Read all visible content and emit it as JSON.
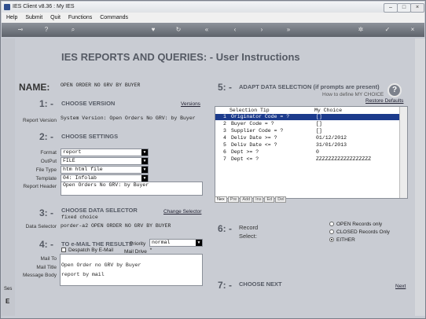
{
  "window": {
    "title": "IES Client v8.36 : My IES"
  },
  "menu": [
    "Help",
    "Submit",
    "Quit",
    "Functions",
    "Commands"
  ],
  "toolbar_icons": [
    "key-icon",
    "help-icon",
    "search-icon",
    "heart-icon",
    "refresh-icon",
    "rewind-icon",
    "back-icon",
    "forward-icon",
    "fast-forward-icon",
    "gear-icon",
    "ok-icon",
    "close-icon"
  ],
  "page": {
    "heading": "IES REPORTS AND QUERIES: -   User Instructions",
    "name_label": "NAME:",
    "name_value": "OPEN ORDER NO GRV  BY BUYER"
  },
  "s1": {
    "num": "1: -",
    "title": "CHOOSE VERSION",
    "link": "Versions",
    "field_label": "Report Version",
    "value": "System Version: Open Orders No GRV: by Buyer"
  },
  "s2": {
    "num": "2: -",
    "title": "CHOOSE SETTINGS",
    "format_label": "Format",
    "format": "report",
    "output_label": "OutPut",
    "output": "FILE",
    "filetype_label": "File Type",
    "filetype": "htm html file",
    "template_label": "Template",
    "template": "04: Infolab",
    "header_label": "Report Header",
    "header": "Open Orders No GRV: by Buyer"
  },
  "s3": {
    "num": "3: -",
    "title": "CHOOSE DATA SELECTOR",
    "link": "Change Selector",
    "choice": "fixed choice",
    "field_label": "Data Selector",
    "value": "porder-a2 OPEN ORDER NO GRV  BY BUYER"
  },
  "s4": {
    "num": "4: -",
    "title": "TO e-MAIL THE RESULTS",
    "priority_label": "Priority",
    "priority": "normal",
    "despatch_label": "Despatch By E-Mail",
    "maildrive_label": "Mail Drive",
    "maildrive_value": "*",
    "mailto_label": "Mail To",
    "mailtitle_label": "Mail Title",
    "mailtitle": "Open Order no GRV  by Buyer",
    "mailbody_label": "Message Body",
    "mailbody": "report by mail"
  },
  "s5": {
    "num": "5: -",
    "title": "ADAPT DATA SELECTION (if prompts are present)",
    "howto": "How to define MY CHOICE",
    "restore": "Restore Defaults",
    "col_tip": "Selection Tip",
    "col_choice": "My Choice",
    "rows": [
      {
        "n": "1",
        "tip": "Originator Code = ?",
        "choice": "[]"
      },
      {
        "n": "2",
        "tip": "Buyer Code = ?",
        "choice": "[]"
      },
      {
        "n": "3",
        "tip": "Supplier Code = ?",
        "choice": "[]"
      },
      {
        "n": "4",
        "tip": "Deliv Date >= ?",
        "choice": "01/12/2012"
      },
      {
        "n": "5",
        "tip": "Deliv Date <= ?",
        "choice": "31/01/2013"
      },
      {
        "n": "6",
        "tip": "Dept >= ?",
        "choice": "0"
      },
      {
        "n": "7",
        "tip": "Dept <= ?",
        "choice": "ZZZZZZZZZZZZZZZZZZ"
      }
    ],
    "tabs": [
      "Nex",
      "Pre",
      "Add",
      "Ins",
      "Ed",
      "Del"
    ]
  },
  "s6": {
    "num": "6: -",
    "title": "Record",
    "subtitle": "Select:",
    "options": [
      "OPEN Records only",
      "CLOSED Records Only",
      "EITHER"
    ],
    "selected": 2
  },
  "s7": {
    "num": "7: -",
    "title": "CHOOSE NEXT",
    "link": "Next"
  },
  "leftstrip": {
    "t1": "Ses",
    "t2": "E"
  }
}
